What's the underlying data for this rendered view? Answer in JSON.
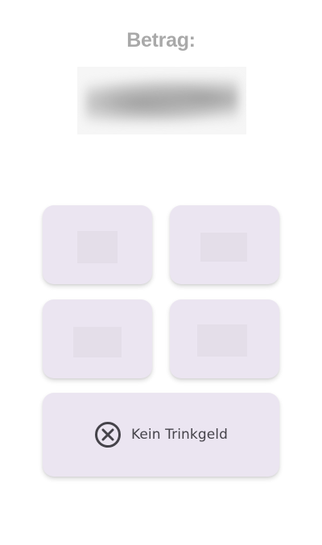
{
  "amount": {
    "label": "Betrag:"
  },
  "tip_options": {
    "no_tip_label": "Kein Trinkgeld",
    "no_tip_icon": "close-circle-icon"
  },
  "colors": {
    "button_bg": "#ebe5f1",
    "label_gray": "#a9a9a9",
    "text_dark": "#45434a"
  }
}
